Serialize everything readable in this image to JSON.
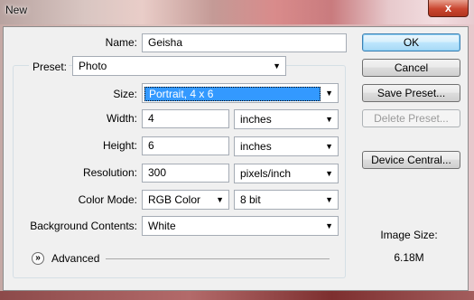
{
  "window": {
    "title": "New",
    "close_glyph": "x"
  },
  "form": {
    "name_label": "Name:",
    "name_value": "Geisha",
    "preset_label": "Preset:",
    "preset_value": "Photo",
    "size_label": "Size:",
    "size_value": "Portrait, 4 x 6",
    "width_label": "Width:",
    "width_value": "4",
    "width_unit": "inches",
    "height_label": "Height:",
    "height_value": "6",
    "height_unit": "inches",
    "resolution_label": "Resolution:",
    "resolution_value": "300",
    "resolution_unit": "pixels/inch",
    "color_mode_label": "Color Mode:",
    "color_mode_value": "RGB Color",
    "bit_depth_value": "8 bit",
    "background_label": "Background Contents:",
    "background_value": "White",
    "advanced_label": "Advanced"
  },
  "buttons": {
    "ok": "OK",
    "cancel": "Cancel",
    "save_preset": "Save Preset...",
    "delete_preset": "Delete Preset...",
    "device_central": "Device Central..."
  },
  "info": {
    "image_size_label": "Image Size:",
    "image_size_value": "6.18M"
  },
  "icons": {
    "dropdown": "chevron-down-icon",
    "advanced": "expand-chevron-icon",
    "close": "close-icon"
  }
}
